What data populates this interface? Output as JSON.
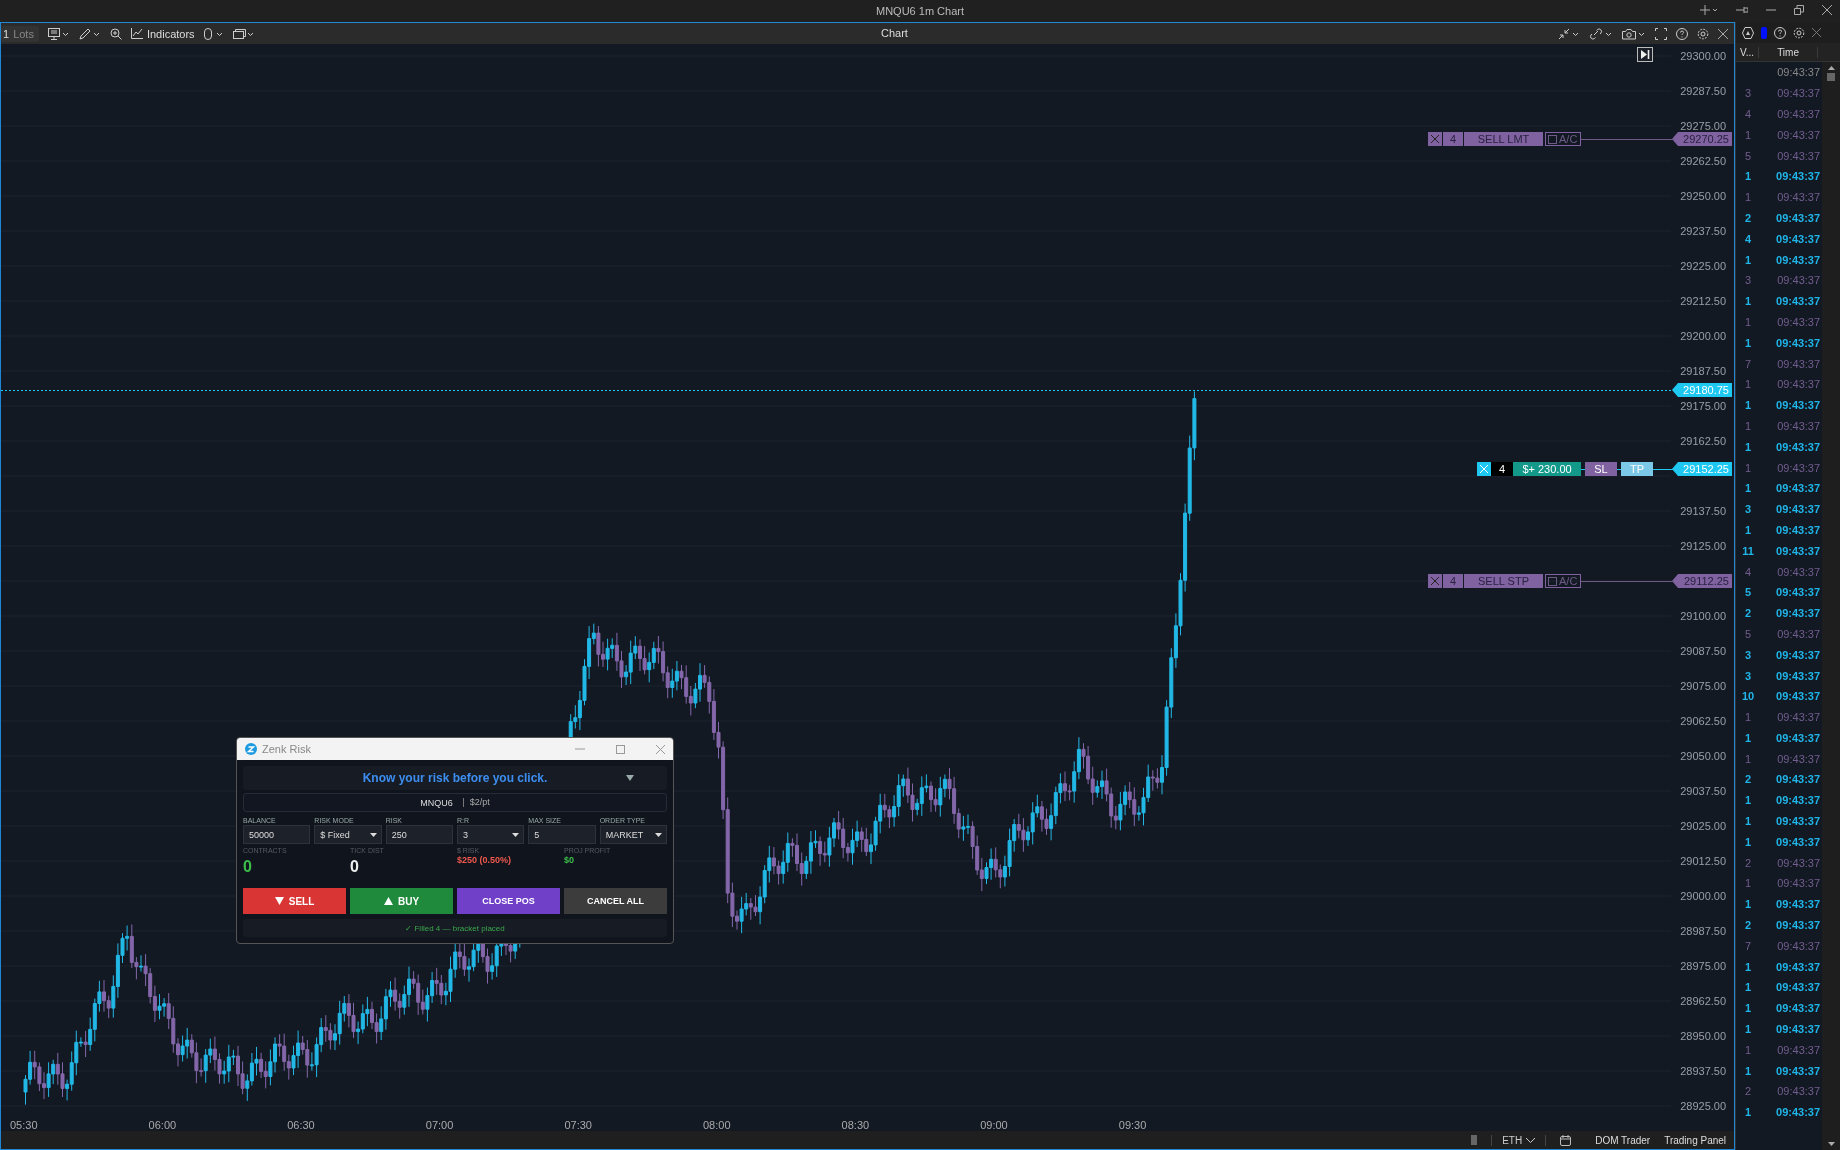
{
  "window": {
    "title": "MNQU6 1m Chart"
  },
  "toolbar": {
    "lots_value": "1",
    "lots_unit": "Lots",
    "indicators": "Indicators",
    "panel_title": "Chart"
  },
  "chart": {
    "price_axis": [
      "29300.00",
      "29287.50",
      "29275.00",
      "29262.50",
      "29250.00",
      "29237.50",
      "29225.00",
      "29212.50",
      "29200.00",
      "29187.50",
      "29175.00",
      "29162.50",
      "29137.50",
      "29125.00",
      "29100.00",
      "29087.50",
      "29075.00",
      "29062.50",
      "29050.00",
      "29037.50",
      "29025.00",
      "29012.50",
      "29000.00",
      "28987.50",
      "28975.00",
      "28962.50",
      "28950.00",
      "28937.50",
      "28925.00"
    ],
    "time_axis": [
      "05:30",
      "06:00",
      "06:30",
      "07:00",
      "07:30",
      "08:00",
      "08:30",
      "09:00",
      "09:30"
    ],
    "price_tags": [
      {
        "label": "29270.25",
        "kind": "order"
      },
      {
        "label": "29180.75",
        "kind": "last"
      },
      {
        "label": "29152.25",
        "kind": "position"
      },
      {
        "label": "29112.25",
        "kind": "order"
      }
    ],
    "orders": [
      {
        "kind": "order",
        "quantity": "4",
        "label": "SELL LMT",
        "ac_label": "A/C",
        "ac_checked": false
      },
      {
        "kind": "position",
        "quantity": "4",
        "label": "$+ 230.00",
        "stop_label": "SL",
        "target_label": "TP"
      },
      {
        "kind": "order",
        "quantity": "4",
        "label": "SELL STP",
        "ac_label": "A/C",
        "ac_checked": false
      }
    ]
  },
  "risk_window": {
    "title": "Zenk Risk",
    "banner": "Know your risk before you click.",
    "symbol": "MNQU6",
    "point_value": "$2/pt",
    "fields": [
      {
        "label": "BALANCE",
        "value": "50000",
        "kind": "input"
      },
      {
        "label": "RISK MODE",
        "value": "$ Fixed",
        "kind": "select"
      },
      {
        "label": "RISK",
        "value": "250",
        "kind": "input"
      },
      {
        "label": "R:R",
        "value": "3",
        "kind": "select"
      },
      {
        "label": "MAX SIZE",
        "value": "5",
        "kind": "input"
      },
      {
        "label": "ORDER TYPE",
        "value": "MARKET",
        "kind": "select"
      }
    ],
    "stats": [
      {
        "label": "CONTRACTS",
        "value": "0",
        "color": "#3cbf4a",
        "kind": "large"
      },
      {
        "label": "TICK DIST",
        "value": "0",
        "color": "#eeeeee",
        "kind": "large"
      },
      {
        "label": "$ RISK",
        "value": "$250 (0.50%)",
        "color": "#f0584e",
        "kind": "small"
      },
      {
        "label": "PROJ PROFIT",
        "value": "$0",
        "color": "#3cbf4a",
        "kind": "small"
      }
    ],
    "actions": [
      {
        "label": "SELL",
        "kind": "sell"
      },
      {
        "label": "BUY",
        "kind": "buy"
      },
      {
        "label": "CLOSE POS",
        "kind": "close"
      },
      {
        "label": "CANCEL ALL",
        "kind": "cancel"
      }
    ],
    "status": "✓ Filled 4 — bracket placed"
  },
  "bottom_bar": {
    "session": "ETH",
    "links": [
      "DOM Trader",
      "Trading Panel"
    ]
  },
  "time_and_sales": {
    "columns": [
      "V...",
      "Time"
    ],
    "rows": [
      {
        "time": "09:43:37",
        "kind": "neutral"
      },
      {
        "volume": "3",
        "time": "09:43:37",
        "kind": "sell"
      },
      {
        "volume": "4",
        "time": "09:43:37",
        "kind": "sell"
      },
      {
        "volume": "1",
        "time": "09:43:37",
        "kind": "sell"
      },
      {
        "volume": "5",
        "time": "09:43:37",
        "kind": "sell"
      },
      {
        "volume": "1",
        "time": "09:43:37",
        "kind": "buy"
      },
      {
        "volume": "1",
        "time": "09:43:37",
        "kind": "sell"
      },
      {
        "volume": "2",
        "time": "09:43:37",
        "kind": "buy"
      },
      {
        "volume": "4",
        "time": "09:43:37",
        "kind": "buy"
      },
      {
        "volume": "1",
        "time": "09:43:37",
        "kind": "buy"
      },
      {
        "volume": "3",
        "time": "09:43:37",
        "kind": "sell"
      },
      {
        "volume": "1",
        "time": "09:43:37",
        "kind": "buy"
      },
      {
        "volume": "1",
        "time": "09:43:37",
        "kind": "sell"
      },
      {
        "volume": "1",
        "time": "09:43:37",
        "kind": "buy"
      },
      {
        "volume": "7",
        "time": "09:43:37",
        "kind": "sell"
      },
      {
        "volume": "1",
        "time": "09:43:37",
        "kind": "sell"
      },
      {
        "volume": "1",
        "time": "09:43:37",
        "kind": "buy"
      },
      {
        "volume": "1",
        "time": "09:43:37",
        "kind": "sell"
      },
      {
        "volume": "1",
        "time": "09:43:37",
        "kind": "buy"
      },
      {
        "volume": "1",
        "time": "09:43:37",
        "kind": "sell"
      },
      {
        "volume": "1",
        "time": "09:43:37",
        "kind": "buy"
      },
      {
        "volume": "3",
        "time": "09:43:37",
        "kind": "buy"
      },
      {
        "volume": "1",
        "time": "09:43:37",
        "kind": "buy"
      },
      {
        "volume": "11",
        "time": "09:43:37",
        "kind": "buy"
      },
      {
        "volume": "4",
        "time": "09:43:37",
        "kind": "sell"
      },
      {
        "volume": "5",
        "time": "09:43:37",
        "kind": "buy"
      },
      {
        "volume": "2",
        "time": "09:43:37",
        "kind": "buy"
      },
      {
        "volume": "5",
        "time": "09:43:37",
        "kind": "sell"
      },
      {
        "volume": "3",
        "time": "09:43:37",
        "kind": "buy"
      },
      {
        "volume": "3",
        "time": "09:43:37",
        "kind": "buy"
      },
      {
        "volume": "10",
        "time": "09:43:37",
        "kind": "buy"
      },
      {
        "volume": "1",
        "time": "09:43:37",
        "kind": "sell"
      },
      {
        "volume": "1",
        "time": "09:43:37",
        "kind": "buy"
      },
      {
        "volume": "1",
        "time": "09:43:37",
        "kind": "sell"
      },
      {
        "volume": "2",
        "time": "09:43:37",
        "kind": "buy"
      },
      {
        "volume": "1",
        "time": "09:43:37",
        "kind": "buy"
      },
      {
        "volume": "1",
        "time": "09:43:37",
        "kind": "buy"
      },
      {
        "volume": "1",
        "time": "09:43:37",
        "kind": "buy"
      },
      {
        "volume": "2",
        "time": "09:43:37",
        "kind": "sell"
      },
      {
        "volume": "1",
        "time": "09:43:37",
        "kind": "sell"
      },
      {
        "volume": "1",
        "time": "09:43:37",
        "kind": "buy"
      },
      {
        "volume": "2",
        "time": "09:43:37",
        "kind": "buy"
      },
      {
        "volume": "7",
        "time": "09:43:37",
        "kind": "sell"
      },
      {
        "volume": "1",
        "time": "09:43:37",
        "kind": "buy"
      },
      {
        "volume": "1",
        "time": "09:43:37",
        "kind": "buy"
      },
      {
        "volume": "1",
        "time": "09:43:37",
        "kind": "buy"
      },
      {
        "volume": "1",
        "time": "09:43:37",
        "kind": "buy"
      },
      {
        "volume": "1",
        "time": "09:43:37",
        "kind": "sell"
      },
      {
        "volume": "1",
        "time": "09:43:37",
        "kind": "buy"
      },
      {
        "volume": "2",
        "time": "09:43:37",
        "kind": "sell"
      },
      {
        "volume": "1",
        "time": "09:43:37",
        "kind": "buy"
      }
    ]
  }
}
